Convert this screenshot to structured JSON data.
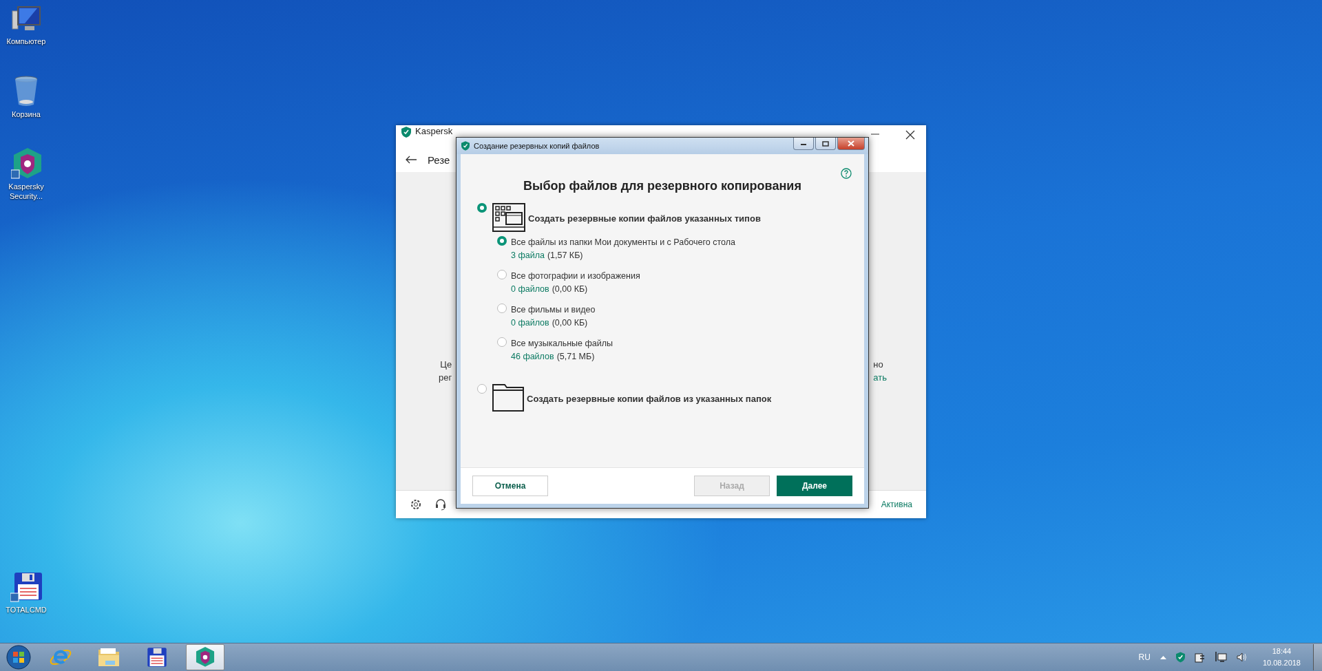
{
  "desktop_icons": [
    {
      "label": "Компьютер",
      "kind": "computer"
    },
    {
      "label": "Корзина",
      "kind": "bin"
    },
    {
      "label": "Kaspersky Security...",
      "kind": "kaspersky"
    },
    {
      "label": "TOTALCMD",
      "kind": "floppy"
    }
  ],
  "main_window": {
    "title": "Kaspersk",
    "heading": "Резе",
    "left_text": [
      "Це",
      "рег"
    ],
    "right_text": [
      {
        "text": "но",
        "link": false
      },
      {
        "text": "ать",
        "link": true
      }
    ],
    "status": "Активна"
  },
  "dialog": {
    "title": "Создание резервных копий файлов",
    "heading": "Выбор файлов для резервного копирования",
    "modes": [
      {
        "kind": "types",
        "label": "Создать резервные копии файлов указанных типов",
        "selected": true,
        "options": [
          {
            "label": "Все файлы из папки Мои документы и с Рабочего стола",
            "count": "3 файла",
            "size": "(1,57 КБ)",
            "selected": true
          },
          {
            "label": "Все фотографии и изображения",
            "count": "0 файлов",
            "size": "(0,00 КБ)",
            "selected": false
          },
          {
            "label": "Все фильмы и видео",
            "count": "0 файлов",
            "size": "(0,00 КБ)",
            "selected": false
          },
          {
            "label": "Все музыкальные файлы",
            "count": "46 файлов",
            "size": "(5,71 МБ)",
            "selected": false
          }
        ]
      },
      {
        "kind": "folders",
        "label": "Создать резервные копии файлов из указанных папок",
        "selected": false
      }
    ],
    "buttons": [
      {
        "label": "Отмена",
        "kind": "secondary",
        "disabled": false
      },
      {
        "label": "Назад",
        "kind": "secondary",
        "disabled": true
      },
      {
        "label": "Далее",
        "kind": "primary",
        "disabled": false
      }
    ]
  },
  "taskbar": {
    "apps": [
      {
        "kind": "ie",
        "active": false
      },
      {
        "kind": "explorer",
        "active": false
      },
      {
        "kind": "floppy",
        "active": false
      },
      {
        "kind": "kaspersky",
        "active": true
      }
    ],
    "language": "RU",
    "time": "18:44",
    "date": "10.08.2018"
  }
}
